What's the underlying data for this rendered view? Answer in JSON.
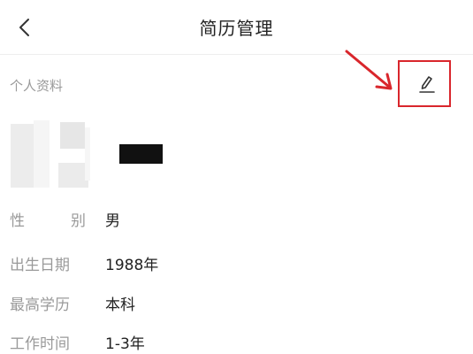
{
  "navbar": {
    "title": "简历管理",
    "back_icon": "chevron-left-icon"
  },
  "profile": {
    "section_label": "个人资料",
    "edit_icon": "pencil-icon",
    "highlight_color": "#d9262c",
    "fields": [
      {
        "label_chars": [
          "性",
          "别"
        ],
        "value": "男"
      },
      {
        "label": "出生日期",
        "value": "1988年"
      },
      {
        "label": "最高学历",
        "value": "本科"
      },
      {
        "label": "工作时间",
        "value": "1-3年"
      }
    ]
  }
}
